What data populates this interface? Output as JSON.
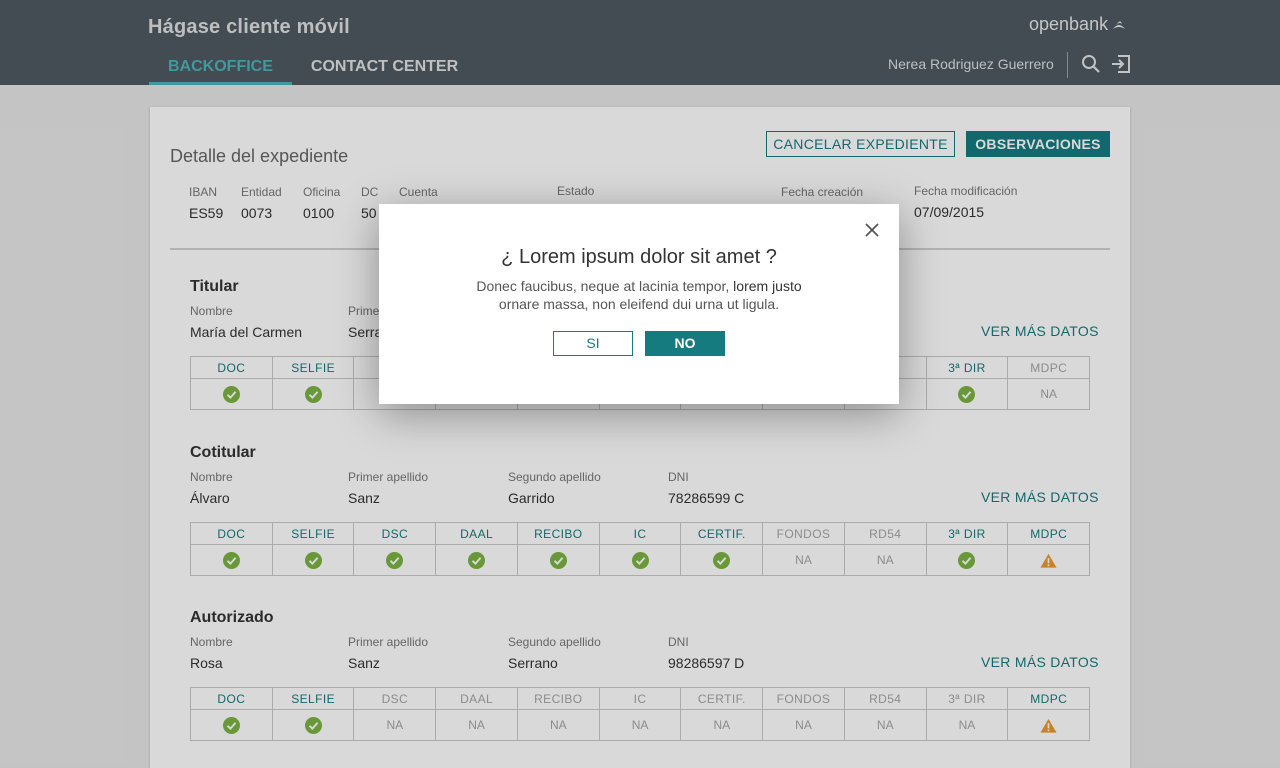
{
  "header": {
    "app_title": "Hágase cliente móvil",
    "logo_text": "openbank",
    "tabs": [
      {
        "label": "BACKOFFICE",
        "active": true
      },
      {
        "label": "CONTACT CENTER",
        "active": false
      }
    ],
    "user_name": "Nerea Rodriguez Guerrero"
  },
  "card": {
    "title": "Detalle del expediente",
    "cancel_label": "CANCELAR EXPEDIENTE",
    "observations_label": "OBSERVACIONES",
    "account": {
      "iban_label": "IBAN",
      "iban": "ES59",
      "entidad_label": "Entidad",
      "entidad": "0073",
      "oficina_label": "Oficina",
      "oficina": "0100",
      "dc_label": "DC",
      "dc": "50",
      "cuenta_label": "Cuenta",
      "estado_label": "Estado",
      "fecha_creacion_label": "Fecha creación",
      "fecha_modificacion_label": "Fecha modificación",
      "fecha_modificacion": "07/09/2015"
    }
  },
  "sections": [
    {
      "title": "Titular",
      "nombre_label": "Nombre",
      "nombre": "María del Carmen",
      "primer_label": "Primer apellido",
      "primer": "Serrano",
      "segundo_label": "",
      "segundo": "",
      "dni_label": "",
      "dni": "",
      "ver_mas": "VER MÁS DATOS",
      "docs": [
        {
          "label": "DOC",
          "state": "ok"
        },
        {
          "label": "SELFIE",
          "state": "ok"
        },
        {
          "label": "",
          "state": "none"
        },
        {
          "label": "",
          "state": "none"
        },
        {
          "label": "",
          "state": "none"
        },
        {
          "label": "",
          "state": "none"
        },
        {
          "label": "",
          "state": "none"
        },
        {
          "label": "",
          "state": "none"
        },
        {
          "label": "",
          "state": "none"
        },
        {
          "label": "3ª DIR",
          "state": "ok"
        },
        {
          "label": "MDPC",
          "state": "na",
          "text": "NA"
        }
      ]
    },
    {
      "title": "Cotitular",
      "nombre_label": "Nombre",
      "nombre": "Álvaro",
      "primer_label": "Primer apellido",
      "primer": "Sanz",
      "segundo_label": "Segundo apellido",
      "segundo": "Garrido",
      "dni_label": "DNI",
      "dni": "78286599 C",
      "ver_mas": "VER MÁS DATOS",
      "docs": [
        {
          "label": "DOC",
          "state": "ok"
        },
        {
          "label": "SELFIE",
          "state": "ok"
        },
        {
          "label": "DSC",
          "state": "ok"
        },
        {
          "label": "DAAL",
          "state": "ok"
        },
        {
          "label": "RECIBO",
          "state": "ok"
        },
        {
          "label": "IC",
          "state": "ok"
        },
        {
          "label": "CERTIF.",
          "state": "ok"
        },
        {
          "label": "FONDOS",
          "state": "na",
          "text": "NA"
        },
        {
          "label": "RD54",
          "state": "na",
          "text": "NA"
        },
        {
          "label": "3ª DIR",
          "state": "ok"
        },
        {
          "label": "MDPC",
          "state": "warn"
        }
      ]
    },
    {
      "title": "Autorizado",
      "nombre_label": "Nombre",
      "nombre": "Rosa",
      "primer_label": "Primer apellido",
      "primer": "Sanz",
      "segundo_label": "Segundo apellido",
      "segundo": "Serrano",
      "dni_label": "DNI",
      "dni": "98286597 D",
      "ver_mas": "VER MÁS DATOS",
      "docs": [
        {
          "label": "DOC",
          "state": "ok"
        },
        {
          "label": "SELFIE",
          "state": "ok"
        },
        {
          "label": "DSC",
          "state": "na",
          "text": "NA"
        },
        {
          "label": "DAAL",
          "state": "na",
          "text": "NA"
        },
        {
          "label": "RECIBO",
          "state": "na",
          "text": "NA"
        },
        {
          "label": "IC",
          "state": "na",
          "text": "NA"
        },
        {
          "label": "CERTIF.",
          "state": "na",
          "text": "NA"
        },
        {
          "label": "FONDOS",
          "state": "na",
          "text": "NA"
        },
        {
          "label": "RD54",
          "state": "na",
          "text": "NA"
        },
        {
          "label": "3ª DIR",
          "state": "na",
          "text": "NA"
        },
        {
          "label": "MDPC",
          "state": "warn"
        }
      ]
    }
  ],
  "modal": {
    "title": "¿ Lorem ipsum dolor sit amet ?",
    "body_part1": "Donec faucibus, neque at lacinia tempor,",
    "body_highlight": "lorem justo",
    "body_part2": "ornare massa, non eleifend dui urna ut ligula.",
    "yes_label": "SI",
    "no_label": "NO"
  },
  "colors": {
    "accent": "#167b7f",
    "header_bg": "#4e5a61",
    "tab_active": "#4fb3b9",
    "ok": "#7cb342",
    "warn": "#e89a2c"
  }
}
